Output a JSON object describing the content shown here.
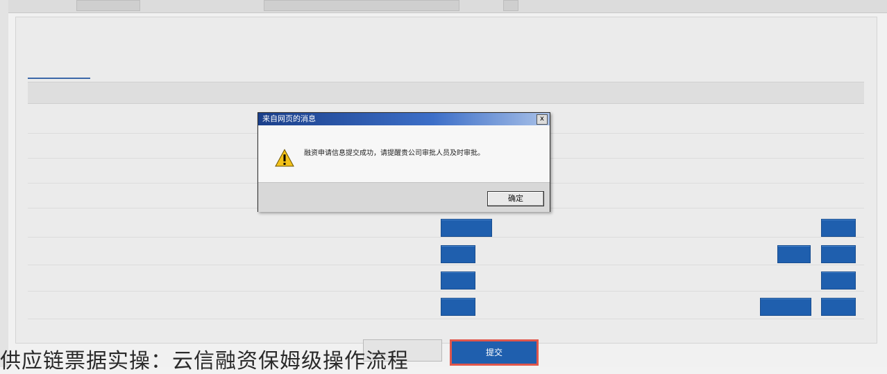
{
  "dialog": {
    "title": "来自网页的消息",
    "close_glyph": "x",
    "message": "融资申请信息提交成功，请提醒贵公司审批人员及时审批。",
    "ok_label": "确定"
  },
  "footer": {
    "primary_label": "提交"
  },
  "caption": "供应链票据实操：云信融资保姆级操作流程",
  "colors": {
    "button_blue": "#1f5fae",
    "link_blue": "#2e5fa8",
    "highlight_red": "#e0564b"
  }
}
